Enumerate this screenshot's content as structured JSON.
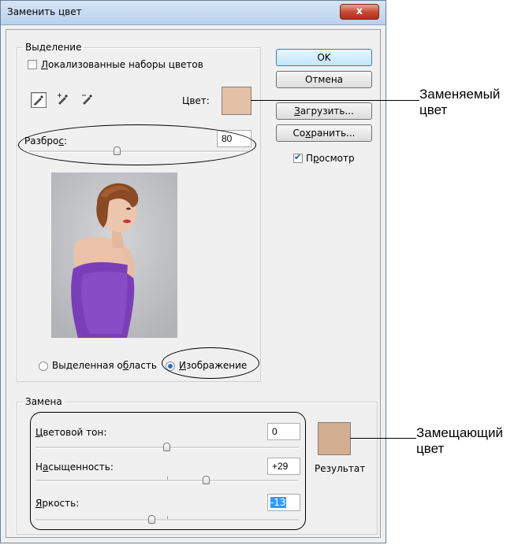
{
  "dialog": {
    "title": "Заменить цвет",
    "close_label": "x"
  },
  "selection": {
    "group_label": "Выделение",
    "localized_label_accel": "Л",
    "localized_label_rest": "окализованные наборы цветов",
    "localized_checked": false,
    "color_label": "Цвет:",
    "color_swatch": "#e3c1a6",
    "fuzziness_label_a": "Разбро",
    "fuzziness_label_accel": "с",
    "fuzziness_label_b": ":",
    "fuzziness_value": "80",
    "fuzziness_fraction": 0.4,
    "radio_selection_a": "Выделенная о",
    "radio_selection_accel": "б",
    "radio_selection_b": "ласть",
    "radio_image_accel": "И",
    "radio_image_rest": "зображение",
    "selected_radio": "image"
  },
  "buttons": {
    "ok": "OK",
    "cancel": "Отмена",
    "load_accel": "З",
    "load_rest": "агрузить...",
    "save_a": "Со",
    "save_accel": "х",
    "save_b": "ранить...",
    "preview_a": "П",
    "preview_accel": "р",
    "preview_b": "осмотр",
    "preview_checked": true
  },
  "replacement": {
    "group_label": "Замена",
    "hue_accel": "Ц",
    "hue_rest": "ветовой тон:",
    "hue_value": "0",
    "saturation_a": "Н",
    "saturation_accel": "а",
    "saturation_b": "сыщенность:",
    "saturation_value": "+29",
    "lightness_accel": "Я",
    "lightness_rest": "ркость:",
    "lightness_value": "-13",
    "result_label": "Результат",
    "result_swatch": "#d3ad90"
  },
  "annotations": {
    "replaced_line1": "Заменяемый",
    "replaced_line2": "цвет",
    "replacing_line1": "Замещающий",
    "replacing_line2": "цвет"
  },
  "colors": {
    "title_gradient_top": "#d7e5f6",
    "close_button": "#c8452e",
    "dress_purple": "#7a3fb8"
  }
}
